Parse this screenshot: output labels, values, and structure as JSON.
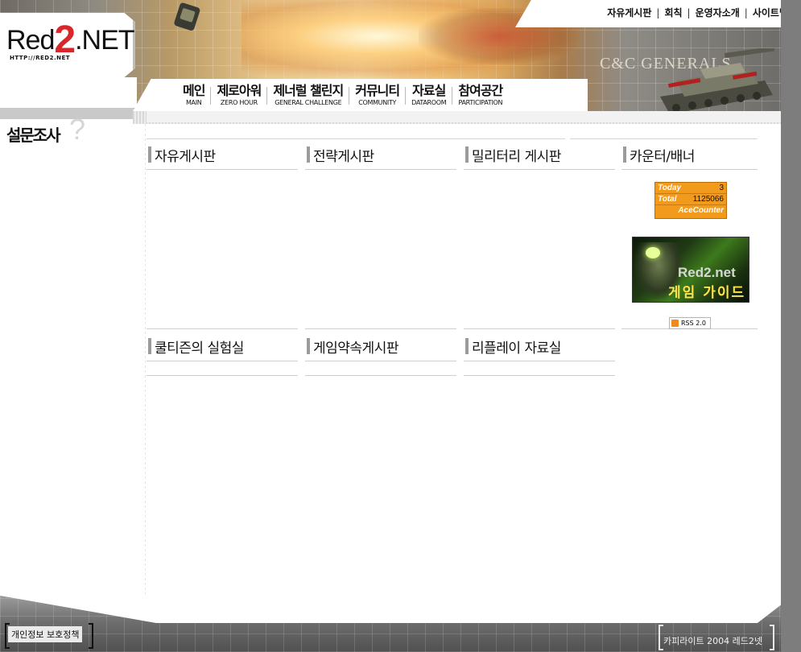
{
  "header": {
    "logo_main": "Red",
    "logo_two": "2",
    "logo_net": ".NET",
    "logo_url": "HTTP://RED2.NET",
    "game_title": "C&C GENERALS",
    "top_links": [
      "자유게시판",
      "회칙",
      "운영자소개",
      "사이트맵"
    ]
  },
  "nav": [
    {
      "ko": "메인",
      "en": "MAIN"
    },
    {
      "ko": "제로아워",
      "en": "ZERO HOUR"
    },
    {
      "ko": "제너럴 챌린지",
      "en": "GENERAL CHALLENGE"
    },
    {
      "ko": "커뮤니티",
      "en": "COMMUNITY"
    },
    {
      "ko": "자료실",
      "en": "DATAROOM"
    },
    {
      "ko": "참여공간",
      "en": "PARTICIPATION"
    }
  ],
  "sidebar": {
    "survey_title": "설문조사",
    "survey_mark": "?"
  },
  "boards": {
    "row1": [
      "자유게시판",
      "전략게시판",
      "밀리터리 게시판",
      "카운터/배너"
    ],
    "row2": [
      "쿨티즌의 실험실",
      "게임약속게시판",
      "리플레이 자료실"
    ]
  },
  "counter": {
    "today_label": "Today",
    "today_value": "3",
    "total_label": "Total",
    "total_value": "1125066",
    "brand": "AceCounter"
  },
  "banner": {
    "line1": "Red2.net",
    "line2": "게임 가이드"
  },
  "rss": {
    "label": "RSS 2.0"
  },
  "footer": {
    "privacy": "개인정보 보호정책",
    "copyright": "카피라이트 2004 레드2넷"
  },
  "colors": {
    "accent_red": "#d8262b",
    "counter_orange": "#f29a1c",
    "banner_yellow": "#ffe34a"
  }
}
